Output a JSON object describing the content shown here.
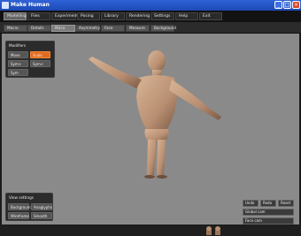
{
  "window": {
    "title": "Make Human"
  },
  "menus": [
    "Modelling",
    "Files",
    "Experiments",
    "Posing",
    "Library",
    "Rendering",
    "Settings",
    "Help",
    "Exit"
  ],
  "subtabs": [
    "Macro",
    "Details",
    "Micro",
    "Asymmetry",
    "Face",
    "Measure",
    "Background"
  ],
  "modifiers": {
    "title": "Modifiers",
    "buttons": [
      "Move",
      "Scale",
      "Sym>",
      "Sym<",
      "Sym"
    ]
  },
  "view_settings": {
    "title": "View settings",
    "buttons": [
      "Background",
      "Anaglyphs",
      "Wireframe",
      "Smooth"
    ]
  },
  "right_controls": {
    "undo": "Undo",
    "redo": "Redo",
    "reset": "Reset",
    "global_cam": "Global cam",
    "face_cam": "Face cam"
  },
  "colors": {
    "accent": "#e06a1d",
    "viewport_bg": "#8a8a8a",
    "titlebar": "#2f62d6"
  }
}
